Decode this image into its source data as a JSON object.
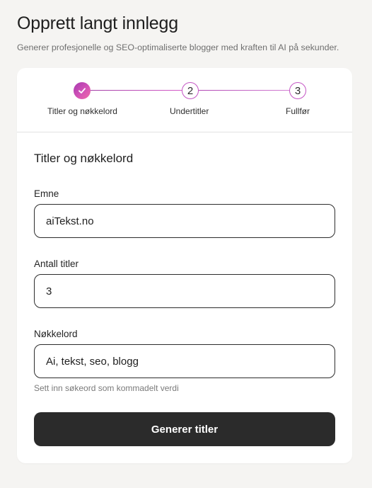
{
  "header": {
    "title": "Opprett langt innlegg",
    "subtitle": "Generer profesjonelle og SEO-optimaliserte blogger med kraften til AI på sekunder."
  },
  "stepper": {
    "steps": [
      {
        "number": "1",
        "label": "Titler og nøkkelord",
        "status": "completed",
        "icon": "check-icon"
      },
      {
        "number": "2",
        "label": "Undertitler",
        "status": "upcoming"
      },
      {
        "number": "3",
        "label": "Fullfør",
        "status": "upcoming"
      }
    ]
  },
  "form": {
    "section_title": "Titler og nøkkelord",
    "emne": {
      "label": "Emne",
      "value": "aiTekst.no"
    },
    "antall_titler": {
      "label": "Antall titler",
      "value": "3"
    },
    "nokkelord": {
      "label": "Nøkkelord",
      "value": "Ai, tekst, seo, blogg",
      "helper": "Sett inn søkeord som kommadelt verdi"
    },
    "submit_label": "Generer titler"
  },
  "colors": {
    "background": "#f5f4f2",
    "card": "#ffffff",
    "accent_gradient_start": "#a63ab0",
    "accent_gradient_end": "#ef6ba5",
    "button": "#2b2b2b"
  }
}
